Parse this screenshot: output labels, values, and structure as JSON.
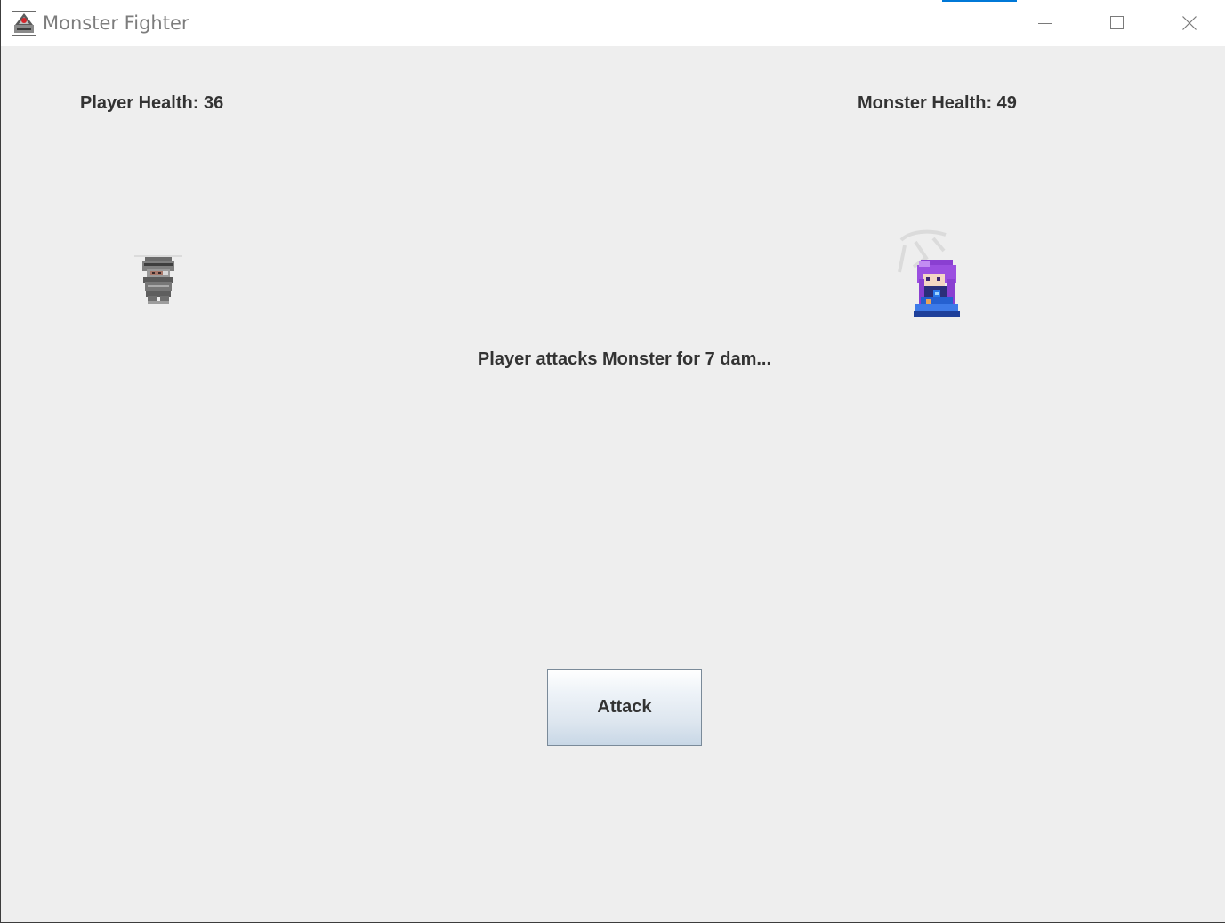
{
  "window": {
    "title": "Monster Fighter",
    "controls": {
      "minimize_icon": "minimize-icon",
      "maximize_icon": "maximize-icon",
      "close_icon": "close-icon"
    }
  },
  "game": {
    "player_health_label": "Player Health: 36",
    "monster_health_label": "Monster Health: 49",
    "message": "Player attacks Monster for 7 dam...",
    "attack_button_label": "Attack",
    "player_sprite": "armored-knight-sprite",
    "monster_sprite": "purple-haired-mage-sprite"
  },
  "colors": {
    "background": "#eeeeee",
    "text": "#333333",
    "titlebar_accent": "#0078d7",
    "button_gradient_top": "#ffffff",
    "button_gradient_bottom": "#c8d7e6"
  }
}
